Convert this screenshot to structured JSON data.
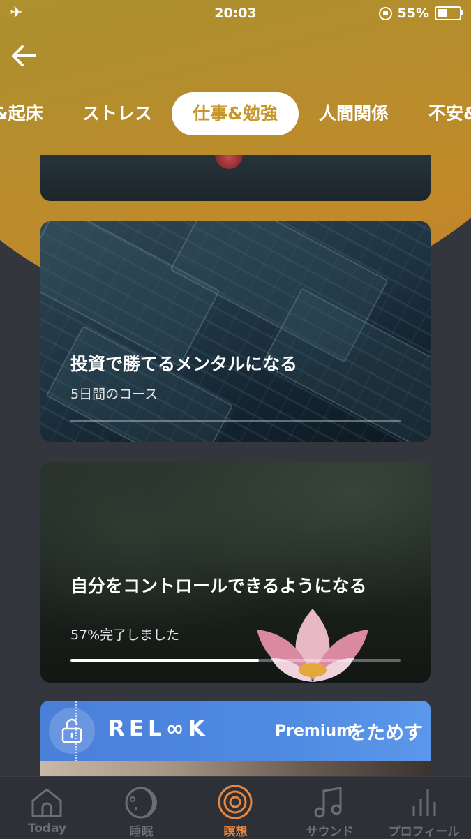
{
  "status_bar": {
    "time": "20:03",
    "battery_percent_label": "55%",
    "battery_level": 0.55
  },
  "tabs": [
    {
      "label": "&起床"
    },
    {
      "label": "ストレス"
    },
    {
      "label": "仕事&勉強",
      "active": true
    },
    {
      "label": "人間関係"
    },
    {
      "label": "不安&"
    }
  ],
  "courses": [
    {
      "title": "投資で勝てるメンタルになる",
      "subtitle": "5日間のコース",
      "progress": 0.0
    },
    {
      "title": "自分をコントロールできるようになる",
      "subtitle": "57%完了しました",
      "progress": 0.57
    }
  ],
  "premium_banner": {
    "brand": "REL∞K",
    "premium": "Premium",
    "cta": "をためす"
  },
  "bottom_nav": [
    {
      "label": "Today",
      "icon": "home-icon"
    },
    {
      "label": "睡眠",
      "icon": "moon-icon"
    },
    {
      "label": "瞑想",
      "icon": "meditation-icon",
      "active": true
    },
    {
      "label": "サウンド",
      "icon": "music-note-icon"
    },
    {
      "label": "プロフィール",
      "icon": "stats-icon"
    }
  ],
  "colors": {
    "accent": "#e8873f",
    "active_tab_text": "#c9962c",
    "background": "#34363e"
  }
}
